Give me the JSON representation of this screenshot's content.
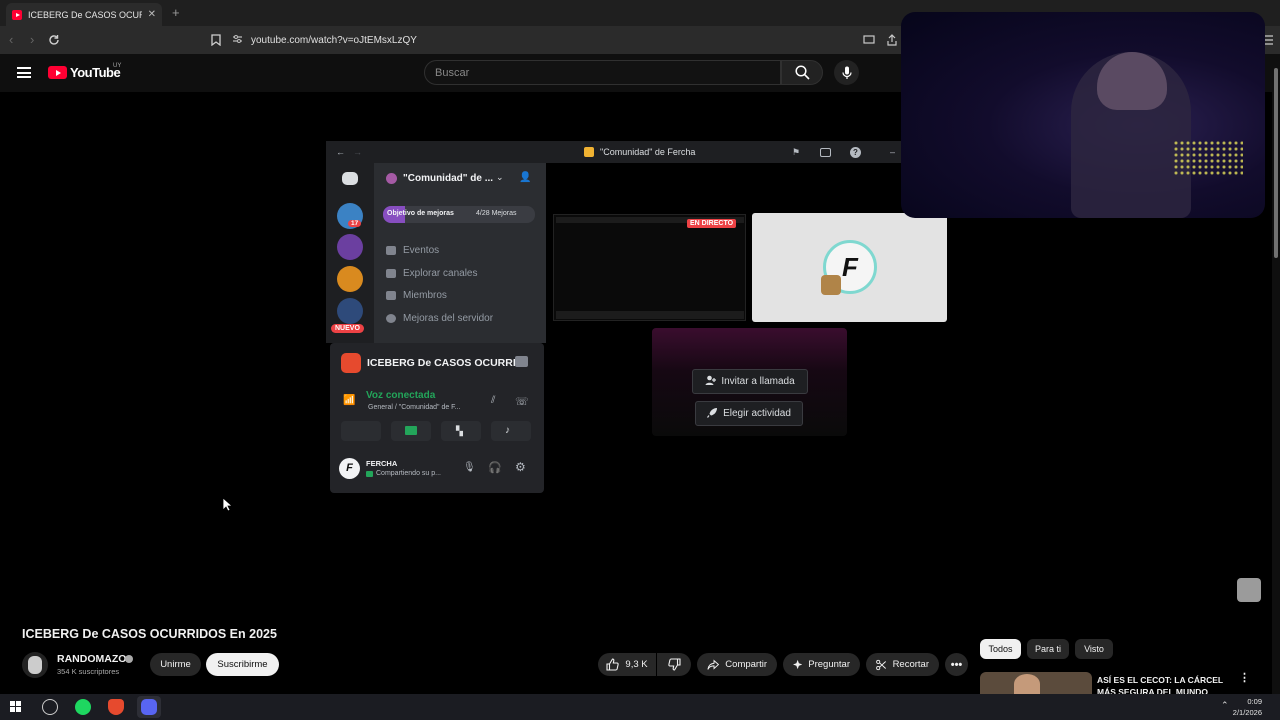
{
  "browser": {
    "tab_title": "ICEBERG De CASOS OCURRIDOS",
    "tab_close": "✕",
    "new_tab": "+",
    "url": "youtube.com/watch?v=oJtEMsxLzQY"
  },
  "youtube": {
    "logo_text": "YouTube",
    "country_code": "UY",
    "search_placeholder": "Buscar"
  },
  "discord": {
    "window_title": "\"Comunidad\" de Fercha",
    "server_name": "\"Comunidad\" de ...",
    "boost_goal": "Objetivo de mejoras",
    "boost_count": "4/28 Mejoras",
    "channels": [
      "Eventos",
      "Explorar canales",
      "Miembros",
      "Mejoras del servidor"
    ],
    "server_badge_count": "17",
    "new_label": "NUEVO",
    "activity_title": "ICEBERG De CASOS OCURRI...",
    "voice_status": "Voz conectada",
    "voice_channel": "General / \"Comunidad\" de F...",
    "username": "FERCHA",
    "user_status": "Compartiendo su p...",
    "live_label": "EN DIRECTO",
    "avatar_letter": "F",
    "invite_button": "Invitar a llamada",
    "activity_button": "Elegir actividad"
  },
  "video": {
    "title": "ICEBERG De CASOS OCURRIDOS En 2025",
    "channel": "RANDOMAZO",
    "subscribers": "354 K suscriptores",
    "join_button": "Unirme",
    "subscribe_button": "Suscribirme",
    "likes": "9,3 K",
    "share_button": "Compartir",
    "ask_button": "Preguntar",
    "clip_button": "Recortar"
  },
  "recommendations": {
    "chips": [
      "Todos",
      "Para ti",
      "Visto"
    ],
    "first_title": "ASÍ ES EL CECOT: LA CÁRCEL MÁS SEGURA DEL MUNDO"
  },
  "taskbar": {
    "time": "0:09",
    "date": "2/1/2026"
  },
  "colors": {
    "youtube_red": "#ff0033",
    "discord_green": "#23a55a",
    "live_red": "#ed4245"
  }
}
